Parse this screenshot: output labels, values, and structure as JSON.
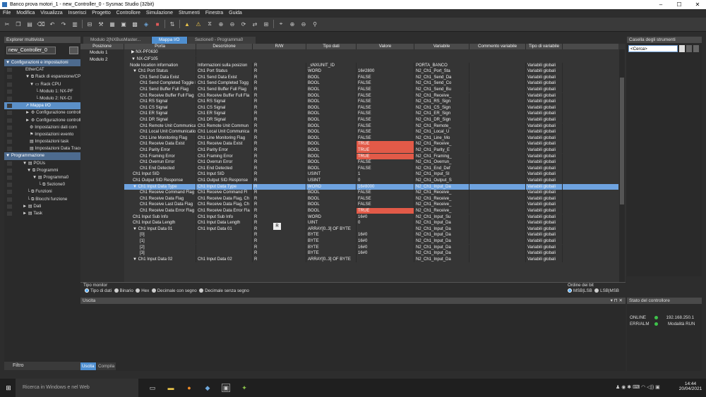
{
  "window": {
    "title": "Banco prova motori_1 - new_Controller_0 - Sysmac Studio (32bit)",
    "min": "–",
    "max": "☐",
    "close": "✕"
  },
  "menu": [
    "File",
    "Modifica",
    "Visualizza",
    "Inserisci",
    "Progetto",
    "Controllore",
    "Simulazione",
    "Strumenti",
    "Finestra",
    "Guida"
  ],
  "explorer": {
    "title": "Explorer multivista",
    "controller": "new_Controller_0",
    "tree": [
      {
        "label": "▼ Configurazioni e impostazioni",
        "indent": 0,
        "type": "sec"
      },
      {
        "label": "EtherCAT",
        "indent": 16,
        "type": "item"
      },
      {
        "label": "▼ ⧉ Rack di espansione/CPU",
        "indent": 16,
        "type": "item"
      },
      {
        "label": "▼ ▭ Rack CPU",
        "indent": 22,
        "type": "item"
      },
      {
        "label": "└  Modulo 1: NX-PF",
        "indent": 30,
        "type": "item"
      },
      {
        "label": "└  Modulo 2: NX-CI",
        "indent": 30,
        "type": "item"
      },
      {
        "label": "↗ Mappa I/O",
        "indent": 16,
        "type": "sel"
      },
      {
        "label": "► ⚙ Configurazione controllo",
        "indent": 16,
        "type": "item"
      },
      {
        "label": "► ⚙ Configurazione controllo",
        "indent": 16,
        "type": "item"
      },
      {
        "label": "⚙ Impostazioni dati com",
        "indent": 22,
        "type": "item"
      },
      {
        "label": "⚑ Impostazioni evento",
        "indent": 22,
        "type": "item"
      },
      {
        "label": "▤ Impostazioni task",
        "indent": 22,
        "type": "item"
      },
      {
        "label": "▤ Impostazioni Data Trace",
        "indent": 22,
        "type": "item"
      },
      {
        "label": "▼ Programmazione",
        "indent": 0,
        "type": "sec"
      },
      {
        "label": "▼ ▤ POUs",
        "indent": 12,
        "type": "item"
      },
      {
        "label": "▼ ⧉ Programmi",
        "indent": 18,
        "type": "item"
      },
      {
        "label": "▼ ▤ Programma0",
        "indent": 26,
        "type": "item"
      },
      {
        "label": "└ ⧉ Sezione0",
        "indent": 34,
        "type": "item"
      },
      {
        "label": "└ ⧉ Funzioni",
        "indent": 18,
        "type": "item"
      },
      {
        "label": "└ ⧉ Blocchi funzione",
        "indent": 18,
        "type": "item"
      },
      {
        "label": "► ▤ Dati",
        "indent": 12,
        "type": "item"
      },
      {
        "label": "► ▤ Task",
        "indent": 12,
        "type": "item"
      }
    ],
    "filter": "Filtro"
  },
  "tabs": [
    {
      "label": "Modulo 2[NXBusMaster...",
      "active": false
    },
    {
      "label": "Mappa I/O",
      "active": true
    },
    {
      "label": "Sezione0 - Programma0",
      "active": false
    }
  ],
  "grid": {
    "headers": [
      "Posizione",
      "Porta",
      "Descrizione",
      "R/W",
      "Tipo dati",
      "Valore",
      "Variabile",
      "Commento variabile",
      "Tipo di variabile"
    ],
    "positions": [
      {
        "pos": "Modulo 1",
        "port": "▶  NX-PF0630"
      },
      {
        "pos": "Modulo 2",
        "port": "▼  NX-CIF105"
      }
    ],
    "rows": [
      [
        "Node location information",
        "Informazioni sulla posizion",
        "R",
        "_sNXUNIT_ID",
        "",
        "PORTA_BANCO",
        "",
        "Variabili globali"
      ],
      [
        "▼ Ch1 Port Status",
        "Ch1 Port Status",
        "R",
        "WORD",
        "16#2800",
        "N2_Ch1_Port_Sta",
        "",
        "Variabili globali"
      ],
      [
        "Ch1 Send Data Exist",
        "Ch1 Send Data Exist",
        "R",
        "BOOL",
        "FALSE",
        "N2_Ch1_Send_Da",
        "",
        "Variabili globali"
      ],
      [
        "Ch1 Send Completed Toggle Bit",
        "Ch1 Send Completed Togg",
        "R",
        "BOOL",
        "FALSE",
        "N2_Ch1_Send_Co",
        "",
        "Variabili globali"
      ],
      [
        "Ch1 Send Buffer Full Flag",
        "Ch1 Send Buffer Full Flag",
        "R",
        "BOOL",
        "FALSE",
        "N2_Ch1_Send_Bu",
        "",
        "Variabili globali"
      ],
      [
        "Ch1 Receive Buffer Full Flag",
        "Ch1 Receive Buffer Full Fla",
        "R",
        "BOOL",
        "FALSE",
        "N2_Ch1_Receive_",
        "",
        "Variabili globali"
      ],
      [
        "Ch1 RS Signal",
        "Ch1 RS Signal",
        "R",
        "BOOL",
        "FALSE",
        "N2_Ch1_RS_Sign",
        "",
        "Variabili globali"
      ],
      [
        "Ch1 CS Signal",
        "Ch1 CS Signal",
        "R",
        "BOOL",
        "FALSE",
        "N2_Ch1_CS_Sign",
        "",
        "Variabili globali"
      ],
      [
        "Ch1 ER Signal",
        "Ch1 ER Signal",
        "R",
        "BOOL",
        "FALSE",
        "N2_Ch1_ER_Sign",
        "",
        "Variabili globali"
      ],
      [
        "Ch1 DR Signal",
        "Ch1 DR Signal",
        "R",
        "BOOL",
        "FALSE",
        "N2_Ch1_DR_Sign",
        "",
        "Variabili globali"
      ],
      [
        "Ch1 Remote Unit Communicatio",
        "Ch1 Remote Unit Commun",
        "R",
        "BOOL",
        "FALSE",
        "N2_Ch1_Remote_",
        "",
        "Variabili globali"
      ],
      [
        "Ch1 Local Unit Communicatio",
        "Ch1 Local Unit Communica",
        "R",
        "BOOL",
        "FALSE",
        "N2_Ch1_Local_U",
        "",
        "Variabili globali"
      ],
      [
        "Ch1 Line Monitoring Flag",
        "Ch1 Line Monitoring Flag",
        "R",
        "BOOL",
        "FALSE",
        "N2_Ch1_Line_Mo",
        "",
        "Variabili globali"
      ],
      [
        "Ch1 Receive Data Exist",
        "Ch1 Receive Data Exist",
        "R",
        "BOOL",
        "TRUE",
        "N2_Ch1_Receive_",
        "",
        "Variabili globali"
      ],
      [
        "Ch1 Parity Error",
        "Ch1 Parity Error",
        "R",
        "BOOL",
        "TRUE",
        "N2_Ch1_Parity_E",
        "",
        "Variabili globali"
      ],
      [
        "Ch1 Framing Error",
        "Ch1 Framing Error",
        "R",
        "BOOL",
        "TRUE",
        "N2_Ch1_Framing_",
        "",
        "Variabili globali"
      ],
      [
        "Ch1 Overrun Error",
        "Ch1 Overrun Error",
        "R",
        "BOOL",
        "FALSE",
        "N2_Ch1_Overrun_",
        "",
        "Variabili globali"
      ],
      [
        "Ch1 End Detected",
        "Ch1 End Detected",
        "R",
        "BOOL",
        "FALSE",
        "N2_Ch1_End_Def",
        "",
        "Variabili globali"
      ],
      [
        "Ch1 Input SID",
        "Ch1 Input SID",
        "R",
        "USINT",
        "1",
        "N2_Ch1_Input_SI",
        "",
        "Variabili globali"
      ],
      [
        "Ch1 Output SID Response",
        "Ch1 Output SID Response",
        "R",
        "USINT",
        "0",
        "N2_Ch1_Output_S",
        "",
        "Variabili globali"
      ],
      [
        "▼ Ch1 Input Data Type",
        "Ch1 Input Data Type",
        "R",
        "WORD",
        "16#8000",
        "N2_Ch1_Input_Da",
        "",
        "Variabili globali"
      ],
      [
        "Ch1 Receive Command Flag",
        "Ch1 Receive Command Fl",
        "R",
        "BOOL",
        "FALSE",
        "N2_Ch1_Receive_",
        "",
        "Variabili globali"
      ],
      [
        "Ch1 Receive Data Flag",
        "Ch1 Receive Data Flag, Ch",
        "R",
        "BOOL",
        "FALSE",
        "N2_Ch1_Receive_",
        "",
        "Variabili globali"
      ],
      [
        "Ch1 Receive Last Data Flag",
        "Ch1 Receive Data Flag, Ch",
        "R",
        "BOOL",
        "FALSE",
        "N2_Ch1_Receive_",
        "",
        "Variabili globali"
      ],
      [
        "Ch1 Receive Data Error Flag",
        "Ch1 Receive Data Error Fla",
        "R",
        "BOOL",
        "TRUE",
        "N2_Ch1_Receive_",
        "",
        "Variabili globali"
      ],
      [
        "Ch1 Input Sub Info",
        "Ch1 Input Sub Info",
        "R",
        "WORD",
        "16#0",
        "N2_Ch1_Input_Su",
        "",
        "Variabili globali"
      ],
      [
        "Ch1 Input Data Length",
        "Ch1 Input Data Length",
        "R",
        "UINT",
        "0",
        "N2_Ch1_Input_Da",
        "",
        "Variabili globali"
      ],
      [
        "▼ Ch1 Input Data 01",
        "Ch1 Input Data 01",
        "R",
        "ARRAY[0..3] OF BYTE",
        "",
        "N2_Ch1_Input_Da",
        "",
        "Variabili globali"
      ],
      [
        "[0]",
        "",
        "R",
        "BYTE",
        "16#0",
        "N2_Ch1_Input_Da",
        "",
        "Variabili globali"
      ],
      [
        "[1]",
        "",
        "R",
        "BYTE",
        "16#0",
        "N2_Ch1_Input_Da",
        "",
        "Variabili globali"
      ],
      [
        "[2]",
        "",
        "R",
        "BYTE",
        "16#0",
        "N2_Ch1_Input_Da",
        "",
        "Variabili globali"
      ],
      [
        "[3]",
        "",
        "R",
        "BYTE",
        "16#0",
        "N2_Ch1_Input_Da",
        "",
        "Variabili globali"
      ],
      [
        "▼ Ch1 Input Data 02",
        "Ch1 Input Data 02",
        "R",
        "ARRAY[0..3] OF BYTE",
        "",
        "N2_Ch1_Input_Da",
        "",
        "Variabili globali"
      ]
    ],
    "tooltip": "R"
  },
  "monitor": {
    "title": "Tipo monitor",
    "options": [
      "Tipo di dati",
      "Binario",
      "Hex",
      "Decimale con segno",
      "Decimale senza segno"
    ],
    "bitorder_title": "Ordine dei bit",
    "bitorder": [
      "MSB|LSB",
      "LSB|MSB"
    ]
  },
  "output": {
    "title": "Uscita",
    "tabs": [
      "Uscita",
      "Compila"
    ],
    "controls": "▾ ⊓ ✕"
  },
  "toolbox": {
    "title": "Casella degli strumenti",
    "search": "<Cerca>"
  },
  "controller_status": {
    "title": "Stato del controllore",
    "rows": [
      {
        "label": "ONLINE",
        "value": "192.168.250.1"
      },
      {
        "label": "ERR/ALM",
        "value": "Modalità RUN"
      }
    ]
  },
  "taskbar": {
    "search": "Ricerca in Windows e nel Web",
    "time": "14:44",
    "date": "20/04/2021",
    "tray": "♟ ◉ ✱ ⌨ ◠ ◁)) ▣"
  }
}
